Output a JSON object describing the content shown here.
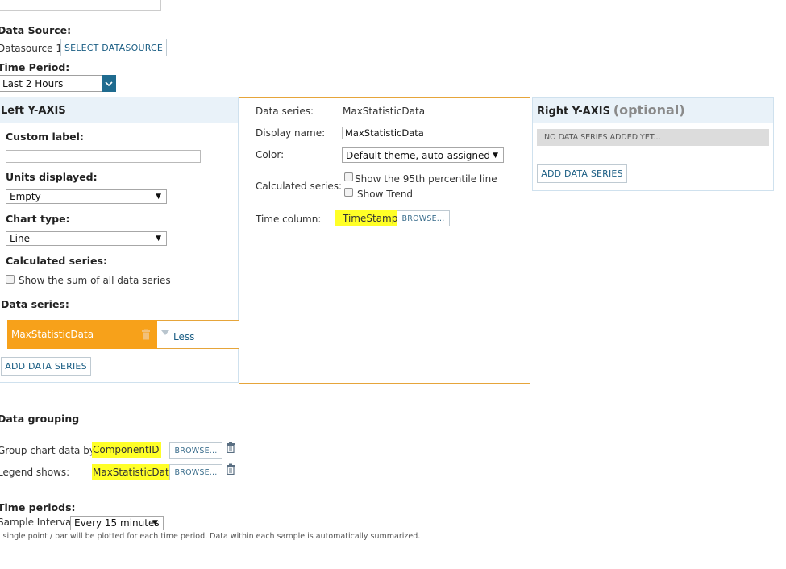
{
  "top": {
    "data_source_label": "Data Source:",
    "data_source_value": "Datasource 1",
    "select_datasource_button": "SELECT DATASOURCE",
    "time_period_label": "Time Period:",
    "time_period_value": "Last 2 Hours"
  },
  "left_axis": {
    "title": "Left Y-AXIS",
    "custom_label_label": "Custom label:",
    "custom_label_value": "",
    "units_label": "Units displayed:",
    "units_value": "Empty",
    "chart_type_label": "Chart type:",
    "chart_type_value": "Line",
    "calculated_label": "Calculated series:",
    "sum_checkbox_label": "Show the sum of all data series",
    "data_series_label": "Data series:",
    "series_item": "MaxStatisticData",
    "less_link": "Less",
    "add_button": "ADD DATA SERIES"
  },
  "series_detail": {
    "data_series_label": "Data series:",
    "data_series_value": "MaxStatisticData",
    "display_name_label": "Display name:",
    "display_name_value": "MaxStatisticData",
    "color_label": "Color:",
    "color_value": "Default theme, auto-assigned",
    "calculated_label": "Calculated series:",
    "percentile_label": "Show the 95th percentile line",
    "trend_label": "Show Trend",
    "time_column_label": "Time column:",
    "time_column_value": "TimeStamp",
    "browse_button": "BROWSE..."
  },
  "right_axis": {
    "title": "Right Y-AXIS",
    "optional": "(optional)",
    "empty_message": "NO DATA SERIES ADDED YET...",
    "add_button": "ADD DATA SERIES"
  },
  "grouping": {
    "title": "Data grouping",
    "group_by_label": "Group chart data by:",
    "group_by_value": "ComponentID",
    "group_browse": "BROWSE...",
    "legend_label": "Legend shows:",
    "legend_value": "MaxStatisticData",
    "legend_browse": "BROWSE..."
  },
  "time_periods": {
    "title": "Time periods:",
    "sample_label": "Sample Interval:",
    "sample_value": "Every 15 minutes",
    "note": "A single point / bar will be plotted for each time period. Data within each sample is automatically summarized."
  },
  "colors": {
    "accent_orange": "#f7a11a",
    "highlight": "#ffff27",
    "link_blue": "#1b5e84",
    "panel_head": "#e9f2f9"
  }
}
